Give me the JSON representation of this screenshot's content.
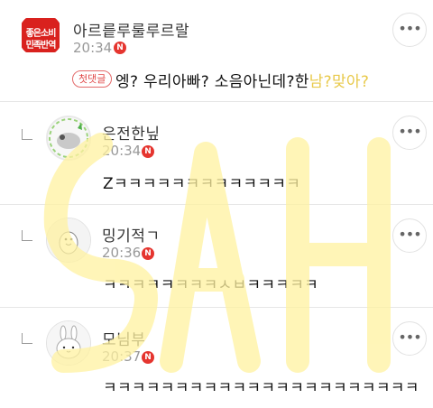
{
  "comments": [
    {
      "author": "아르릍루룰루르랄",
      "time": "20:34",
      "badge": "N",
      "tag": "첫댓글",
      "text_main": "엥? 우리아빠? 소음아닌데?한",
      "text_highlight": "남?맞아?",
      "avatar_text": [
        "좋은소비",
        "민족반역"
      ]
    },
    {
      "author": "은전한닢",
      "time": "20:34",
      "badge": "N",
      "text": "Zㅋㅋㅋㅋㅋㅋㅋㅋㅋㅋㅋㅋㅋ"
    },
    {
      "author": "밍기적ㄱ",
      "time": "20:36",
      "badge": "N",
      "text": "ㅋㅋㅋㅋㅋㅋㅋㅋㅅㅂㅋㅋㅋㅋㅋ"
    },
    {
      "author": "모님부",
      "time": "20:37",
      "badge": "N",
      "text": "ㅋㅋㅋㅋㅋㅋㅋㅋㅋㅋㅋㅋㅋㅋㅋㅋㅋㅋㅋㅋㅋㅋ"
    }
  ],
  "more_label": "•••",
  "watermark": "SAH",
  "colors": {
    "badge_red": "#e5352f",
    "highlight_yellow": "#e8c94a",
    "watermark_yellow": "#fff2a0"
  }
}
